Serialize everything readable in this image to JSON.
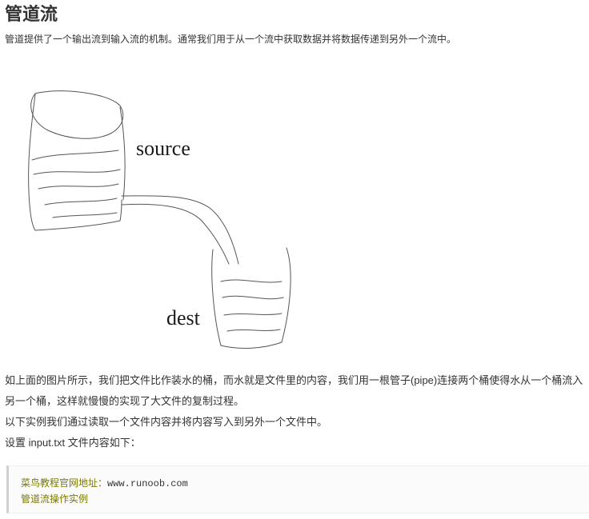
{
  "article": {
    "title": "管道流",
    "intro": "管道提供了一个输出流到输入流的机制。通常我们用于从一个流中获取数据并将数据传递到另外一个流中。",
    "figure": {
      "source_label": "source",
      "dest_label": "dest"
    },
    "paragraphs": [
      "如上面的图片所示，我们把文件比作装水的桶，而水就是文件里的内容，我们用一根管子(pipe)连接两个桶使得水从一个桶流入另一个桶，这样就慢慢的实现了大文件的复制过程。",
      "以下实例我们通过读取一个文件内容并将内容写入到另外一个文件中。",
      "设置 input.txt 文件内容如下："
    ],
    "code": {
      "line1_label": "菜鸟教程官网地址：",
      "line1_value": "www.runoob.com",
      "line2": "管道流操作实例"
    }
  }
}
